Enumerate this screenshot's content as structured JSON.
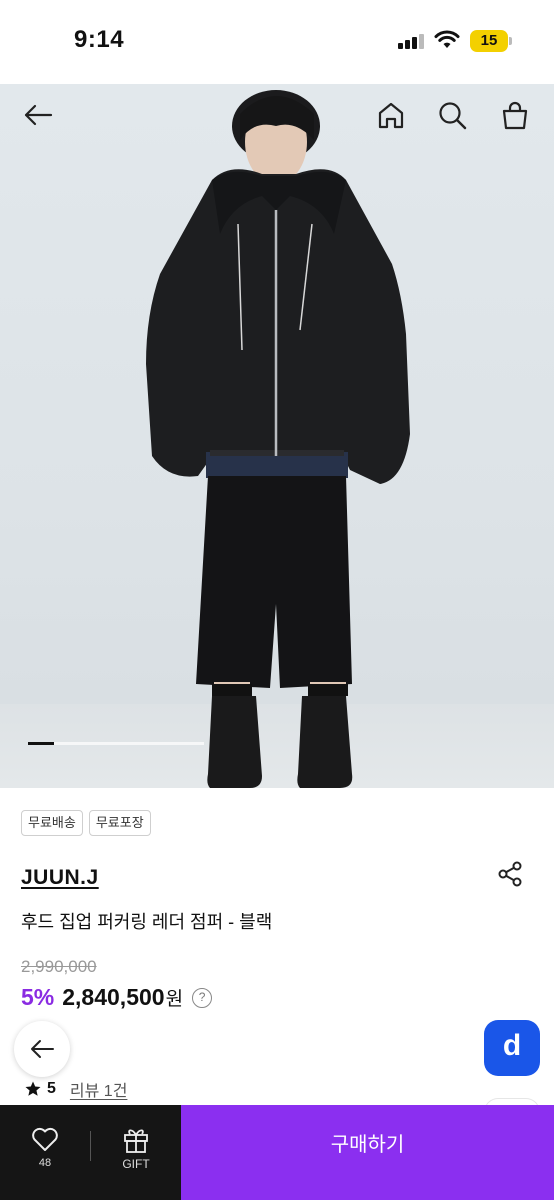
{
  "status_bar": {
    "time": "9:14",
    "battery": "15"
  },
  "hero": {
    "nav": {
      "back_icon": "arrow-left-icon",
      "home_icon": "home-icon",
      "search_icon": "search-icon",
      "cart_icon": "shopping-bag-icon"
    },
    "slide_progress": 0.15
  },
  "product": {
    "badges": [
      "무료배송",
      "무료포장"
    ],
    "brand": "JUUN.J",
    "name": "후드 집업 퍼커링 레더 점퍼 - 블랙",
    "original_price": "2,990,000",
    "discount": "5%",
    "price": "2,840,500",
    "currency": "원",
    "help": "?",
    "rating": "5",
    "review_link": "리뷰 1건"
  },
  "floating": {
    "back_icon": "arrow-left-icon",
    "d_label": "d"
  },
  "bottom_bar": {
    "like_count": "48",
    "gift_label": "GIFT",
    "buy_label": "구매하기"
  },
  "colors": {
    "accent": "#8b2ff0",
    "discount": "#8a2be2",
    "d_button": "#1a56e8",
    "bottom_bar": "#151515"
  }
}
